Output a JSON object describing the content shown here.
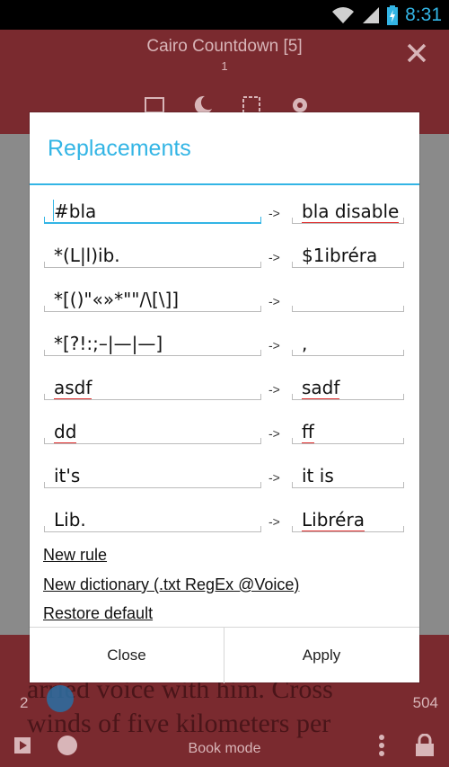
{
  "status_bar": {
    "time": "8:31",
    "icons": [
      "wifi-icon",
      "signal-icon",
      "battery-charging-icon"
    ]
  },
  "app": {
    "title": "Cairo Countdown [5]",
    "page_indicator": "1",
    "footer": {
      "page_left": "2",
      "page_right": "504",
      "text_line1": "arried voice with him. Cross",
      "text_line2": "winds of five kilometers per",
      "mode_label": "Book mode"
    }
  },
  "dialog": {
    "title": "Replacements",
    "arrow": "->",
    "rules": [
      {
        "find": "#bla",
        "replace": "bla disable"
      },
      {
        "find": "*(L|l)ib.",
        "replace": "$1ibréra"
      },
      {
        "find": "*[()\"«»*\"\"/\\[\\]]",
        "replace": ""
      },
      {
        "find": "*[?!:;–|—|—]",
        "replace": ","
      },
      {
        "find": "asdf",
        "replace": "sadf"
      },
      {
        "find": "dd",
        "replace": "ff"
      },
      {
        "find": "it's",
        "replace": "it is"
      },
      {
        "find": "Lib.",
        "replace": "Libréra"
      }
    ],
    "links": {
      "new_rule": "New rule",
      "new_dictionary": "New dictionary (.txt RegEx @Voice)",
      "restore_default": "Restore default"
    },
    "buttons": {
      "close": "Close",
      "apply": "Apply"
    }
  },
  "colors": {
    "accent": "#33b5e5",
    "app_bar": "#7a2a2f",
    "spellcheck": "#e03030"
  }
}
